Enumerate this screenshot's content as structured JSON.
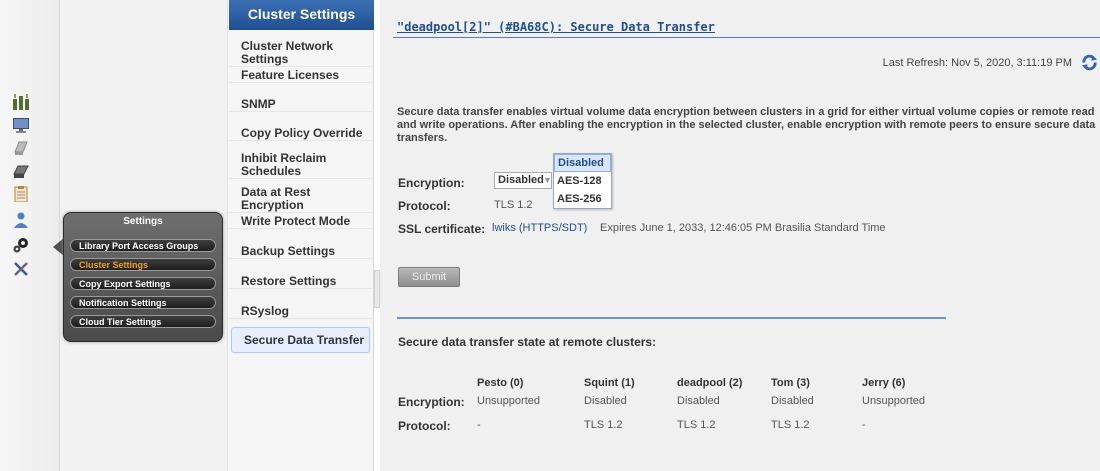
{
  "left_icons": [
    "cluster-icon",
    "monitor-icon",
    "disk-icon",
    "tape-drive-icon",
    "clipboard-icon",
    "user-icon",
    "settings-gears-icon",
    "tools-icon"
  ],
  "popup": {
    "title": "Settings",
    "items": [
      {
        "label": "Library Port Access Groups"
      },
      {
        "label": "Cluster Settings"
      },
      {
        "label": "Copy Export Settings"
      },
      {
        "label": "Notification Settings"
      },
      {
        "label": "Cloud Tier Settings"
      }
    ]
  },
  "sidebar": {
    "header": "Cluster Settings",
    "items": [
      {
        "label": "Cluster Network Settings"
      },
      {
        "label": "Feature Licenses"
      },
      {
        "label": "SNMP"
      },
      {
        "label": "Copy Policy Override"
      },
      {
        "label": "Inhibit Reclaim Schedules"
      },
      {
        "label": "Data at Rest Encryption"
      },
      {
        "label": "Write Protect Mode"
      },
      {
        "label": "Backup Settings"
      },
      {
        "label": "Restore Settings"
      },
      {
        "label": "RSyslog"
      },
      {
        "label": "Secure Data Transfer"
      }
    ]
  },
  "page": {
    "title": "\"deadpool[2]\" (#BA68C): Secure Data Transfer",
    "last_refresh_label": "Last Refresh:",
    "last_refresh_value": "Nov 5, 2020, 3:11:19 PM",
    "description": "Secure data transfer enables virtual volume data encryption between clusters in a grid for either virtual volume copies or remote read and write operations. After enabling the encryption in the selected cluster, enable encryption with remote peers to ensure secure data transfers.",
    "encryption_label": "Encryption:",
    "encryption_value": "Disabled",
    "encryption_options": [
      "Disabled",
      "AES-128",
      "AES-256"
    ],
    "protocol_label": "Protocol:",
    "protocol_value": "TLS 1.2",
    "ssl_label": "SSL certificate:",
    "ssl_link": "lwiks (HTTPS/SDT)",
    "ssl_expires": "Expires June 1, 2033, 12:46:05 PM Brasilia Standard Time",
    "submit_label": "Submit"
  },
  "remote": {
    "title": "Secure data transfer state at remote clusters:",
    "columns": [
      "Pesto (0)",
      "Squint (1)",
      "deadpool (2)",
      "Tom (3)",
      "Jerry (6)"
    ],
    "rows": [
      {
        "label": "Encryption:",
        "values": [
          "Unsupported",
          "Disabled",
          "Disabled",
          "Disabled",
          "Unsupported"
        ]
      },
      {
        "label": "Protocol:",
        "values": [
          "-",
          "TLS 1.2",
          "TLS 1.2",
          "TLS 1.2",
          "-"
        ]
      }
    ]
  },
  "colors": {
    "header_blue": "#1f4f92",
    "accent_orange": "#f0a020",
    "rule_blue": "#6a96d8"
  }
}
